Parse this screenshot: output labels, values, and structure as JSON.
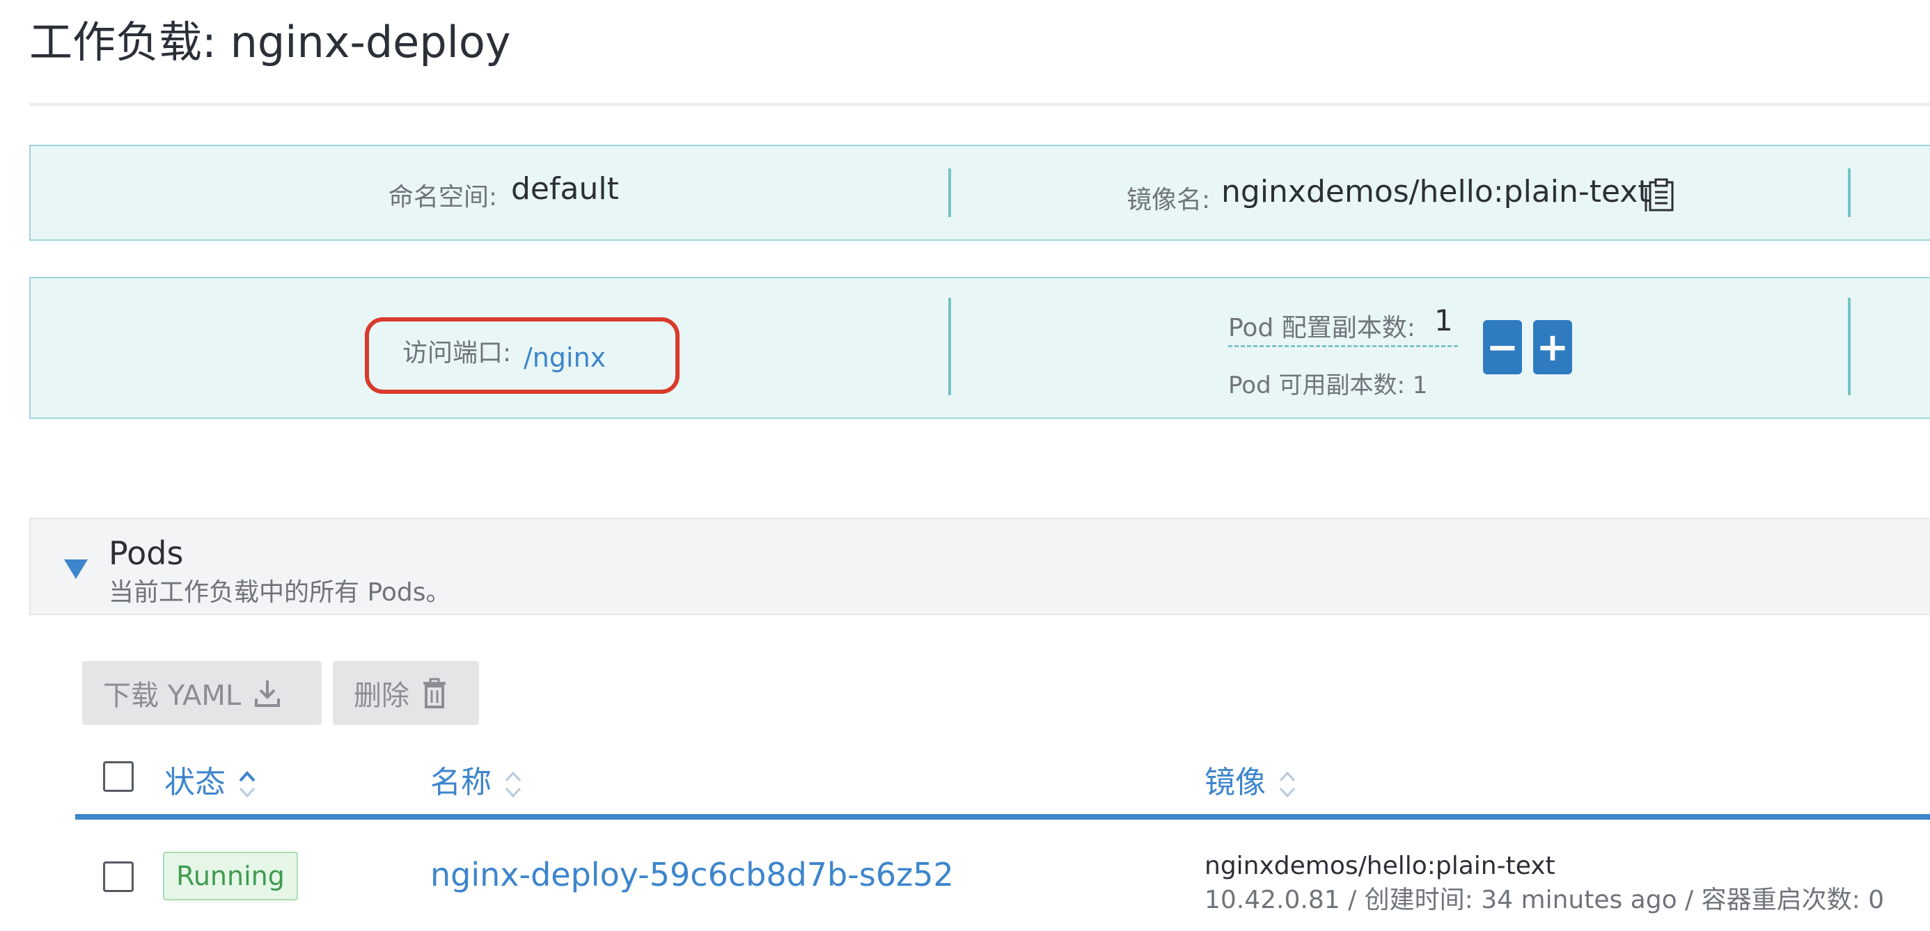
{
  "header": {
    "title": "工作负载: nginx-deploy"
  },
  "info_row1": {
    "namespace_label": "命名空间:",
    "namespace_value": "default",
    "image_label": "镜像名:",
    "image_value": "nginxdemos/hello:plain-text",
    "copy_icon": "clipboard-icon"
  },
  "info_row2": {
    "port_label": "访问端口:",
    "port_link": "/nginx",
    "replicas_config_label": "Pod 配置副本数:",
    "replicas_config_value": "1",
    "replicas_available": "Pod 可用副本数: 1",
    "minus_label": "−",
    "plus_label": "+"
  },
  "pods": {
    "title": "Pods",
    "subtitle": "当前工作负载中的所有 Pods。",
    "download_yaml": "下载 YAML",
    "delete": "删除",
    "columns": {
      "state": "状态",
      "name": "名称",
      "image": "镜像"
    },
    "rows": [
      {
        "state": "Running",
        "name": "nginx-deploy-59c6cb8d7b-s6z52",
        "image": "nginxdemos/hello:plain-text",
        "meta": "10.42.0.81 / 创建时间: 34 minutes ago / 容器重启次数: 0"
      }
    ]
  },
  "colors": {
    "accent": "#3d85cc",
    "info_bg": "#e9f6f6",
    "highlight": "#d83a2c",
    "running_green": "#3f9b4f"
  }
}
